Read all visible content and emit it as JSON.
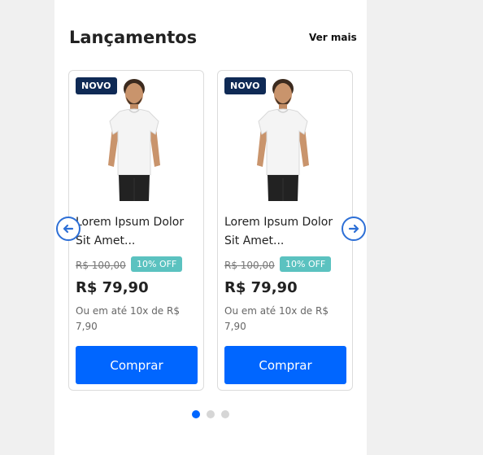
{
  "section": {
    "title": "Lançamentos",
    "see_more_label": "Ver mais"
  },
  "products": [
    {
      "badge": "NOVO",
      "name": "Lorem Ipsum Dolor Sit Amet...",
      "old_price": "R$ 100,00",
      "discount": "10% OFF",
      "price": "R$ 79,90",
      "installments": "Ou em até 10x de R$ 7,90",
      "buy_label": "Comprar"
    },
    {
      "badge": "NOVO",
      "name": "Lorem Ipsum Dolor Sit Amet...",
      "old_price": "R$ 100,00",
      "discount": "10% OFF",
      "price": "R$ 79,90",
      "installments": "Ou em até 10x de R$ 7,90",
      "buy_label": "Comprar"
    }
  ],
  "carousel": {
    "prev_icon": "arrow-left-icon",
    "next_icon": "arrow-right-icon",
    "page_count": 3,
    "active_page": 1
  },
  "colors": {
    "accent": "#0066ff",
    "badge": "#0f2a55",
    "discount": "#5bc2c0"
  }
}
